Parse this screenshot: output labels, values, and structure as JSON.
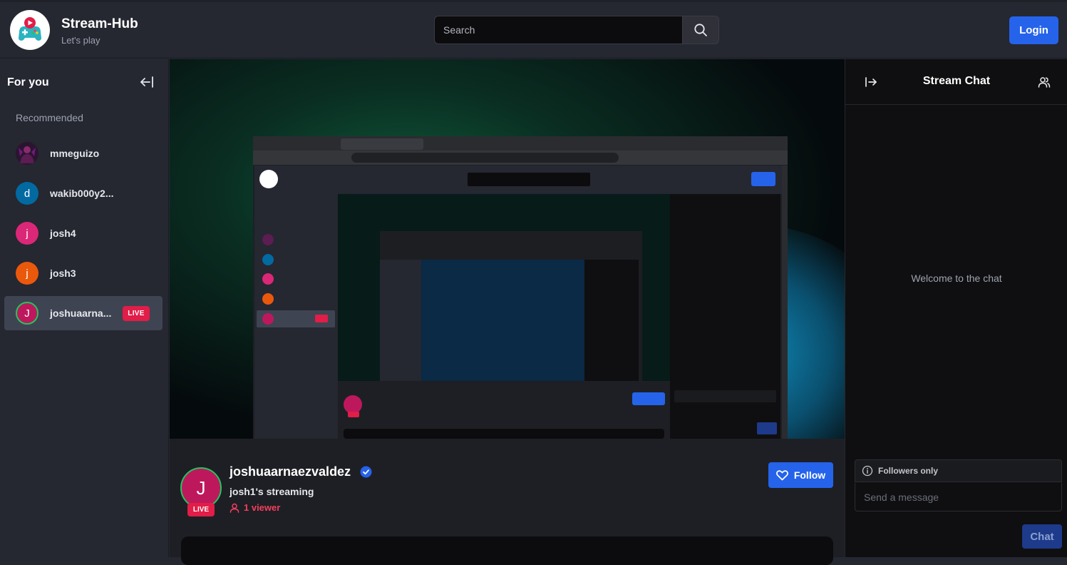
{
  "navbar": {
    "brand_title": "Stream-Hub",
    "brand_subtitle": "Let's play",
    "search_placeholder": "Search",
    "login_label": "Login"
  },
  "sidebar": {
    "title": "For you",
    "section_label": "Recommended",
    "items": [
      {
        "name": "mmeguizo",
        "initial": "",
        "color": "#3b1f3a",
        "live": false
      },
      {
        "name": "wakib000y2...",
        "initial": "d",
        "color": "#0369a1",
        "live": false
      },
      {
        "name": "josh4",
        "initial": "j",
        "color": "#db2777",
        "live": false
      },
      {
        "name": "josh3",
        "initial": "j",
        "color": "#ea580c",
        "live": false
      },
      {
        "name": "joshuaarna...",
        "initial": "J",
        "color": "#be185d",
        "live": true,
        "live_label": "LIVE"
      }
    ]
  },
  "stream": {
    "streamer_name": "joshuaarnaezvaldez",
    "avatar_initial": "J",
    "live_label": "LIVE",
    "title": "josh1's streaming",
    "viewers": "1 viewer",
    "follow_label": "Follow"
  },
  "chat": {
    "title": "Stream Chat",
    "welcome": "Welcome to the chat",
    "followers_only": "Followers only",
    "input_placeholder": "Send a message",
    "send_label": "Chat"
  },
  "colors": {
    "accent": "#2563eb",
    "live": "#e11d48",
    "viewer": "#f43f5e"
  }
}
